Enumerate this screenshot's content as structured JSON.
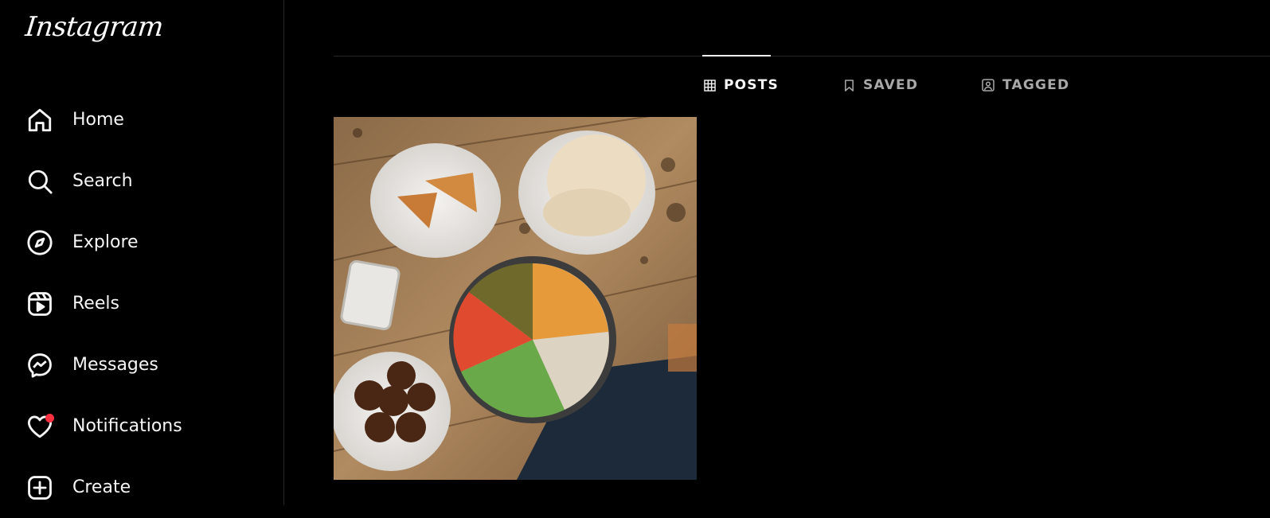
{
  "brand": {
    "logo_text": "Instagram"
  },
  "sidebar": {
    "items": [
      {
        "label": "Home",
        "icon": "home-icon"
      },
      {
        "label": "Search",
        "icon": "search-icon"
      },
      {
        "label": "Explore",
        "icon": "compass-icon"
      },
      {
        "label": "Reels",
        "icon": "reels-icon"
      },
      {
        "label": "Messages",
        "icon": "messenger-icon"
      },
      {
        "label": "Notifications",
        "icon": "heart-icon",
        "has_badge": true
      },
      {
        "label": "Create",
        "icon": "plus-square-icon"
      }
    ]
  },
  "profile_tabs": [
    {
      "label": "POSTS",
      "icon": "grid-icon",
      "active": true
    },
    {
      "label": "SAVED",
      "icon": "bookmark-icon",
      "active": false
    },
    {
      "label": "TAGGED",
      "icon": "tagged-icon",
      "active": false
    }
  ],
  "colors": {
    "background": "#000000",
    "text_primary": "#f5f5f5",
    "text_secondary": "#a8a8a8",
    "divider": "#262626",
    "notification_badge": "#ff3040"
  },
  "posts": [
    {
      "thumbnail": "food-photo-falafel-platter"
    }
  ]
}
